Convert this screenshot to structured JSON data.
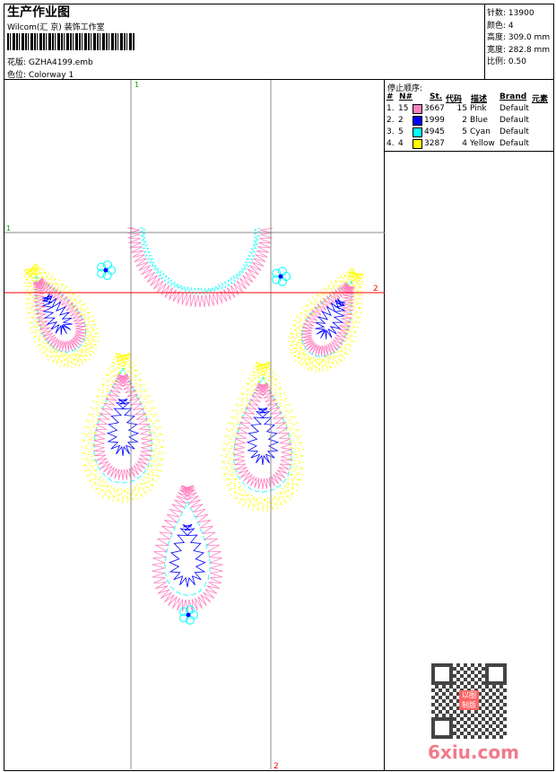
{
  "header": {
    "title": "生产作业图",
    "company": "Wilcom(汇 京) 装饰工作室",
    "design_label": "花版:",
    "design_file": "GZHA4199.emb",
    "colorway_label": "色位:",
    "colorway": "Colorway 1"
  },
  "info": [
    {
      "label": "针数:",
      "value": "13900"
    },
    {
      "label": "颜色:",
      "value": "4"
    },
    {
      "label": "高度:",
      "value": "309.0 mm"
    },
    {
      "label": "宽度:",
      "value": "282.8 mm"
    },
    {
      "label": "比例:",
      "value": "0.50"
    }
  ],
  "stop_sequence": {
    "title": "停止顺序:",
    "headers": {
      "num": "#",
      "n": "N#",
      "st": "St.",
      "code": "代码",
      "desc": "描述",
      "brand": "Brand",
      "elem": "元素"
    },
    "rows": [
      {
        "num": "1.",
        "n": "15",
        "color": "#ff80c0",
        "st": "3667",
        "code": "15",
        "desc": "Pink",
        "brand": "Default"
      },
      {
        "num": "2.",
        "n": "2",
        "color": "#0000ff",
        "st": "1999",
        "code": "2",
        "desc": "Blue",
        "brand": "Default"
      },
      {
        "num": "3.",
        "n": "5",
        "color": "#00ffff",
        "st": "4945",
        "code": "5",
        "desc": "Cyan",
        "brand": "Default"
      },
      {
        "num": "4.",
        "n": "4",
        "color": "#ffff00",
        "st": "3287",
        "code": "4",
        "desc": "Yellow",
        "brand": "Default"
      }
    ]
  },
  "guides": {
    "v1": "1",
    "h1": "1",
    "h2": "2",
    "v2": "2"
  },
  "watermark": {
    "site": "6xiu.com",
    "seal": "以图制版"
  }
}
